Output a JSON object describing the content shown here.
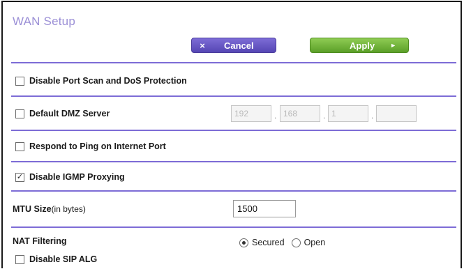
{
  "header": {
    "title": "WAN Setup"
  },
  "toolbar": {
    "cancel_label": "Cancel",
    "cancel_icon": "×",
    "apply_label": "Apply",
    "apply_icon": "►"
  },
  "options": {
    "port_scan": {
      "label": "Disable Port Scan and DoS Protection",
      "checked": false
    },
    "dmz": {
      "label": "Default DMZ Server",
      "checked": false,
      "ip": [
        "192",
        "168",
        "1",
        ""
      ],
      "dot": "."
    },
    "ping": {
      "label": "Respond to Ping on Internet Port",
      "checked": false
    },
    "igmp": {
      "label": "Disable IGMP Proxying",
      "checked": true,
      "mark": "✓"
    },
    "mtu": {
      "label": "MTU Size",
      "unit": "(in bytes)",
      "value": "1500"
    },
    "nat": {
      "label": "NAT Filtering",
      "secured_label": "Secured",
      "open_label": "Open",
      "selected": "Secured"
    },
    "sip": {
      "label": "Disable SIP ALG",
      "checked": false
    }
  },
  "colors": {
    "accent": "#7d6cd6",
    "apply": "#6aae33",
    "title": "#9b8fd6"
  }
}
